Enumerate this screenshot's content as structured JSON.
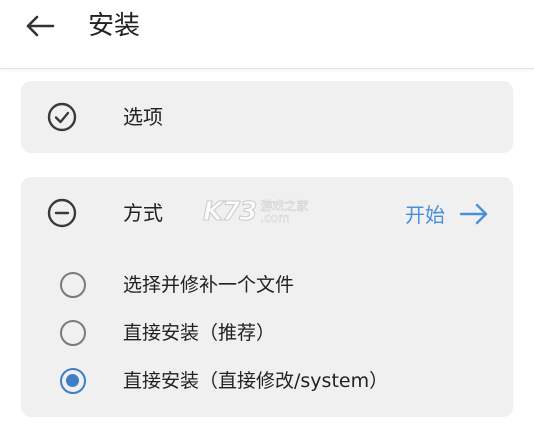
{
  "app_bar": {
    "title": "安装",
    "back_icon": "arrow-left-icon"
  },
  "options_card": {
    "label": "选项",
    "icon": "check-circle-icon"
  },
  "method_card": {
    "label": "方式",
    "icon": "minus-circle-icon",
    "start_label": "开始",
    "start_icon": "arrow-right-icon",
    "accent_color": "#4a90d9",
    "options": [
      {
        "label": "选择并修补一个文件",
        "checked": false
      },
      {
        "label": "直接安装（推荐）",
        "checked": false
      },
      {
        "label": "直接安装（直接修改/system）",
        "checked": true
      }
    ]
  },
  "watermark": {
    "logo": "K73",
    "line1": "游戏之家",
    "line2": ".com"
  }
}
